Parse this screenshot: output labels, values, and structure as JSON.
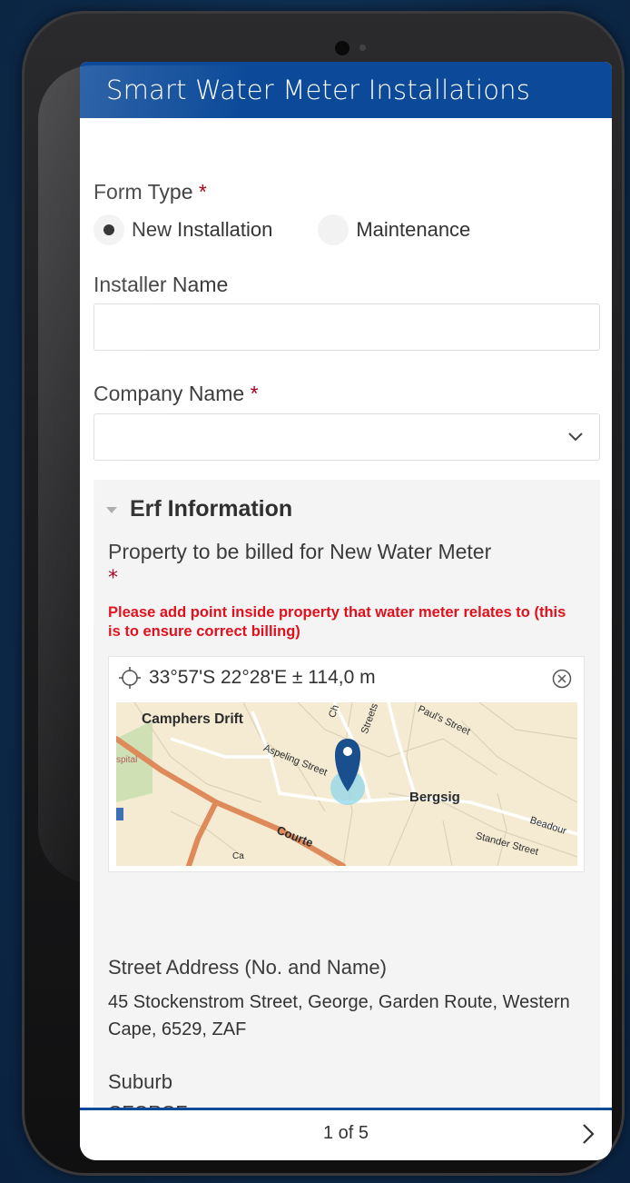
{
  "header": {
    "title": "Smart Water Meter Installations"
  },
  "form": {
    "form_type": {
      "label": "Form Type",
      "required_marker": "*",
      "options": [
        "New Installation",
        "Maintenance"
      ],
      "selected": "New Installation"
    },
    "installer_name": {
      "label": "Installer Name",
      "value": ""
    },
    "company_name": {
      "label": "Company Name",
      "required_marker": "*",
      "value": ""
    },
    "erf_group": {
      "title": "Erf Information",
      "property": {
        "label": "Property to be billed for New Water Meter",
        "required_marker": "*",
        "hint": "Please add point inside property that water meter relates to (this is to ensure correct billing)",
        "coordinates": "33°57'S 22°28'E ± 114,0 m",
        "map_labels": [
          "Camphers Drift",
          "Bergsig",
          "Courte",
          "Ch",
          "Streets",
          "Paul's Street",
          "Aspeling Street",
          "Stander Street",
          "Beadour",
          "spital",
          "Ca"
        ]
      },
      "street_address": {
        "label": "Street Address (No. and Name)",
        "value": "45 Stockenstrom Street, George, Garden Route, Western Cape, 6529, ZAF"
      },
      "suburb": {
        "label": "Suburb",
        "value": "GEORGE"
      }
    }
  },
  "footer": {
    "page_indicator": "1 of 5"
  },
  "colors": {
    "header": "#0c4a99",
    "required": "#a8001b",
    "hint": "#e0101c",
    "background": "#0c2746"
  }
}
